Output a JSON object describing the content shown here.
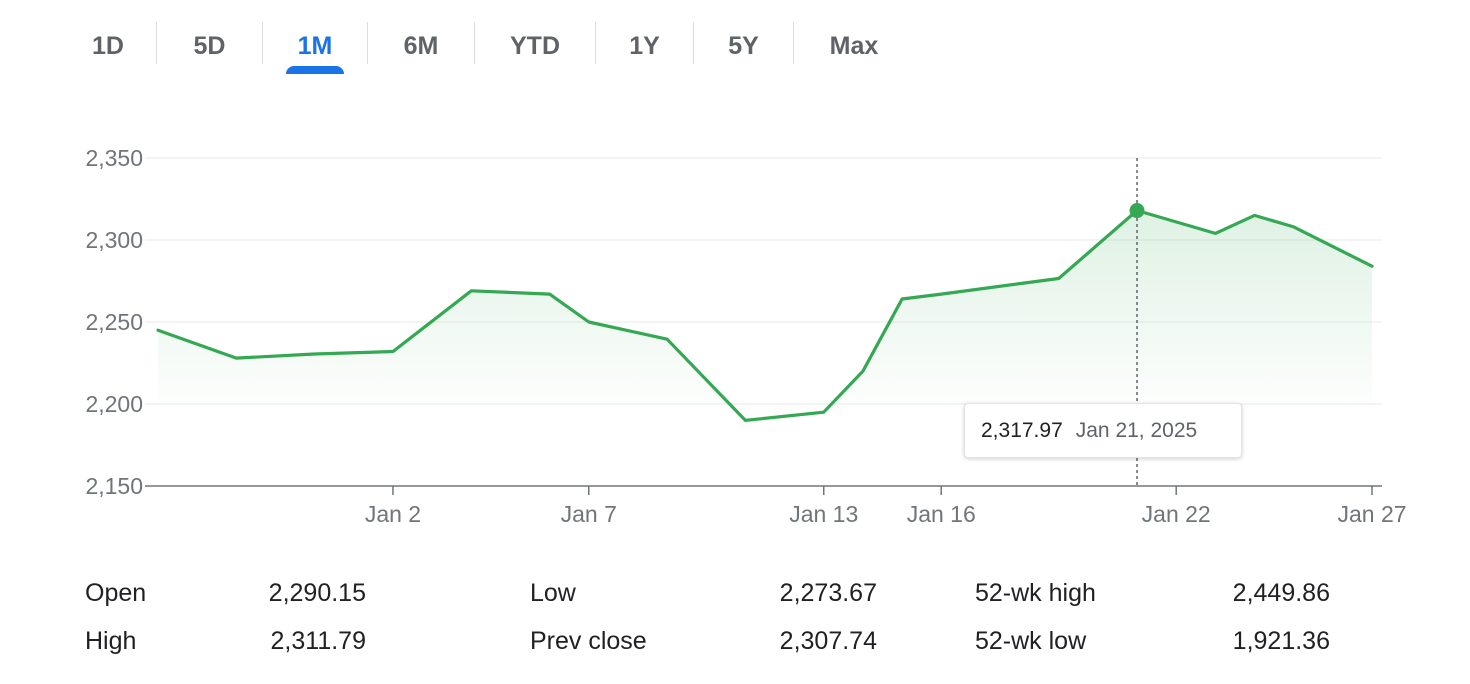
{
  "tabs": [
    {
      "label": "1D",
      "active": false
    },
    {
      "label": "5D",
      "active": false
    },
    {
      "label": "1M",
      "active": true
    },
    {
      "label": "6M",
      "active": false
    },
    {
      "label": "YTD",
      "active": false
    },
    {
      "label": "1Y",
      "active": false
    },
    {
      "label": "5Y",
      "active": false
    },
    {
      "label": "Max",
      "active": false
    }
  ],
  "colors": {
    "line": "#34a853",
    "accent": "#1a73e8",
    "grid": "#eeeeee",
    "axis": "#70757a"
  },
  "chart_data": {
    "type": "area",
    "title": "",
    "xlabel": "",
    "ylabel": "",
    "ylim": [
      2150,
      2350
    ],
    "yticks": [
      2150,
      2200,
      2250,
      2300,
      2350
    ],
    "ytick_labels": [
      "2,150",
      "2,200",
      "2,250",
      "2,300",
      "2,350"
    ],
    "xlim": [
      "2024-12-27",
      "2025-01-27"
    ],
    "xticks": [
      {
        "label": "Jan 2",
        "date": "2025-01-02"
      },
      {
        "label": "Jan 7",
        "date": "2025-01-07"
      },
      {
        "label": "Jan 13",
        "date": "2025-01-13"
      },
      {
        "label": "Jan 16",
        "date": "2025-01-16"
      },
      {
        "label": "Jan 22",
        "date": "2025-01-22"
      },
      {
        "label": "Jan 27",
        "date": "2025-01-27"
      }
    ],
    "grid": true,
    "series": [
      {
        "points": [
          {
            "x": "2024-12-27",
            "y": 2245
          },
          {
            "x": "2024-12-29",
            "y": 2228
          },
          {
            "x": "2024-12-31",
            "y": 2230.5
          },
          {
            "x": "2025-01-02",
            "y": 2232
          },
          {
            "x": "2025-01-04",
            "y": 2269
          },
          {
            "x": "2025-01-06",
            "y": 2267
          },
          {
            "x": "2025-01-07",
            "y": 2250
          },
          {
            "x": "2025-01-09",
            "y": 2239.5
          },
          {
            "x": "2025-01-11",
            "y": 2190
          },
          {
            "x": "2025-01-13",
            "y": 2195
          },
          {
            "x": "2025-01-14",
            "y": 2220
          },
          {
            "x": "2025-01-15",
            "y": 2264
          },
          {
            "x": "2025-01-16",
            "y": 2267
          },
          {
            "x": "2025-01-19",
            "y": 2276.5
          },
          {
            "x": "2025-01-21",
            "y": 2317.97
          },
          {
            "x": "2025-01-23",
            "y": 2304
          },
          {
            "x": "2025-01-24",
            "y": 2315
          },
          {
            "x": "2025-01-25",
            "y": 2308
          },
          {
            "x": "2025-01-27",
            "y": 2284
          }
        ]
      }
    ],
    "highlight": {
      "x": "2025-01-21",
      "y": 2317.97
    }
  },
  "tooltip": {
    "price": "2,317.97",
    "date": "Jan 21, 2025"
  },
  "stats": {
    "col1": [
      {
        "label": "Open",
        "value": "2,290.15"
      },
      {
        "label": "High",
        "value": "2,311.79"
      }
    ],
    "col2": [
      {
        "label": "Low",
        "value": "2,273.67"
      },
      {
        "label": "Prev close",
        "value": "2,307.74"
      }
    ],
    "col3": [
      {
        "label": "52-wk high",
        "value": "2,449.86"
      },
      {
        "label": "52-wk low",
        "value": "1,921.36"
      }
    ]
  }
}
